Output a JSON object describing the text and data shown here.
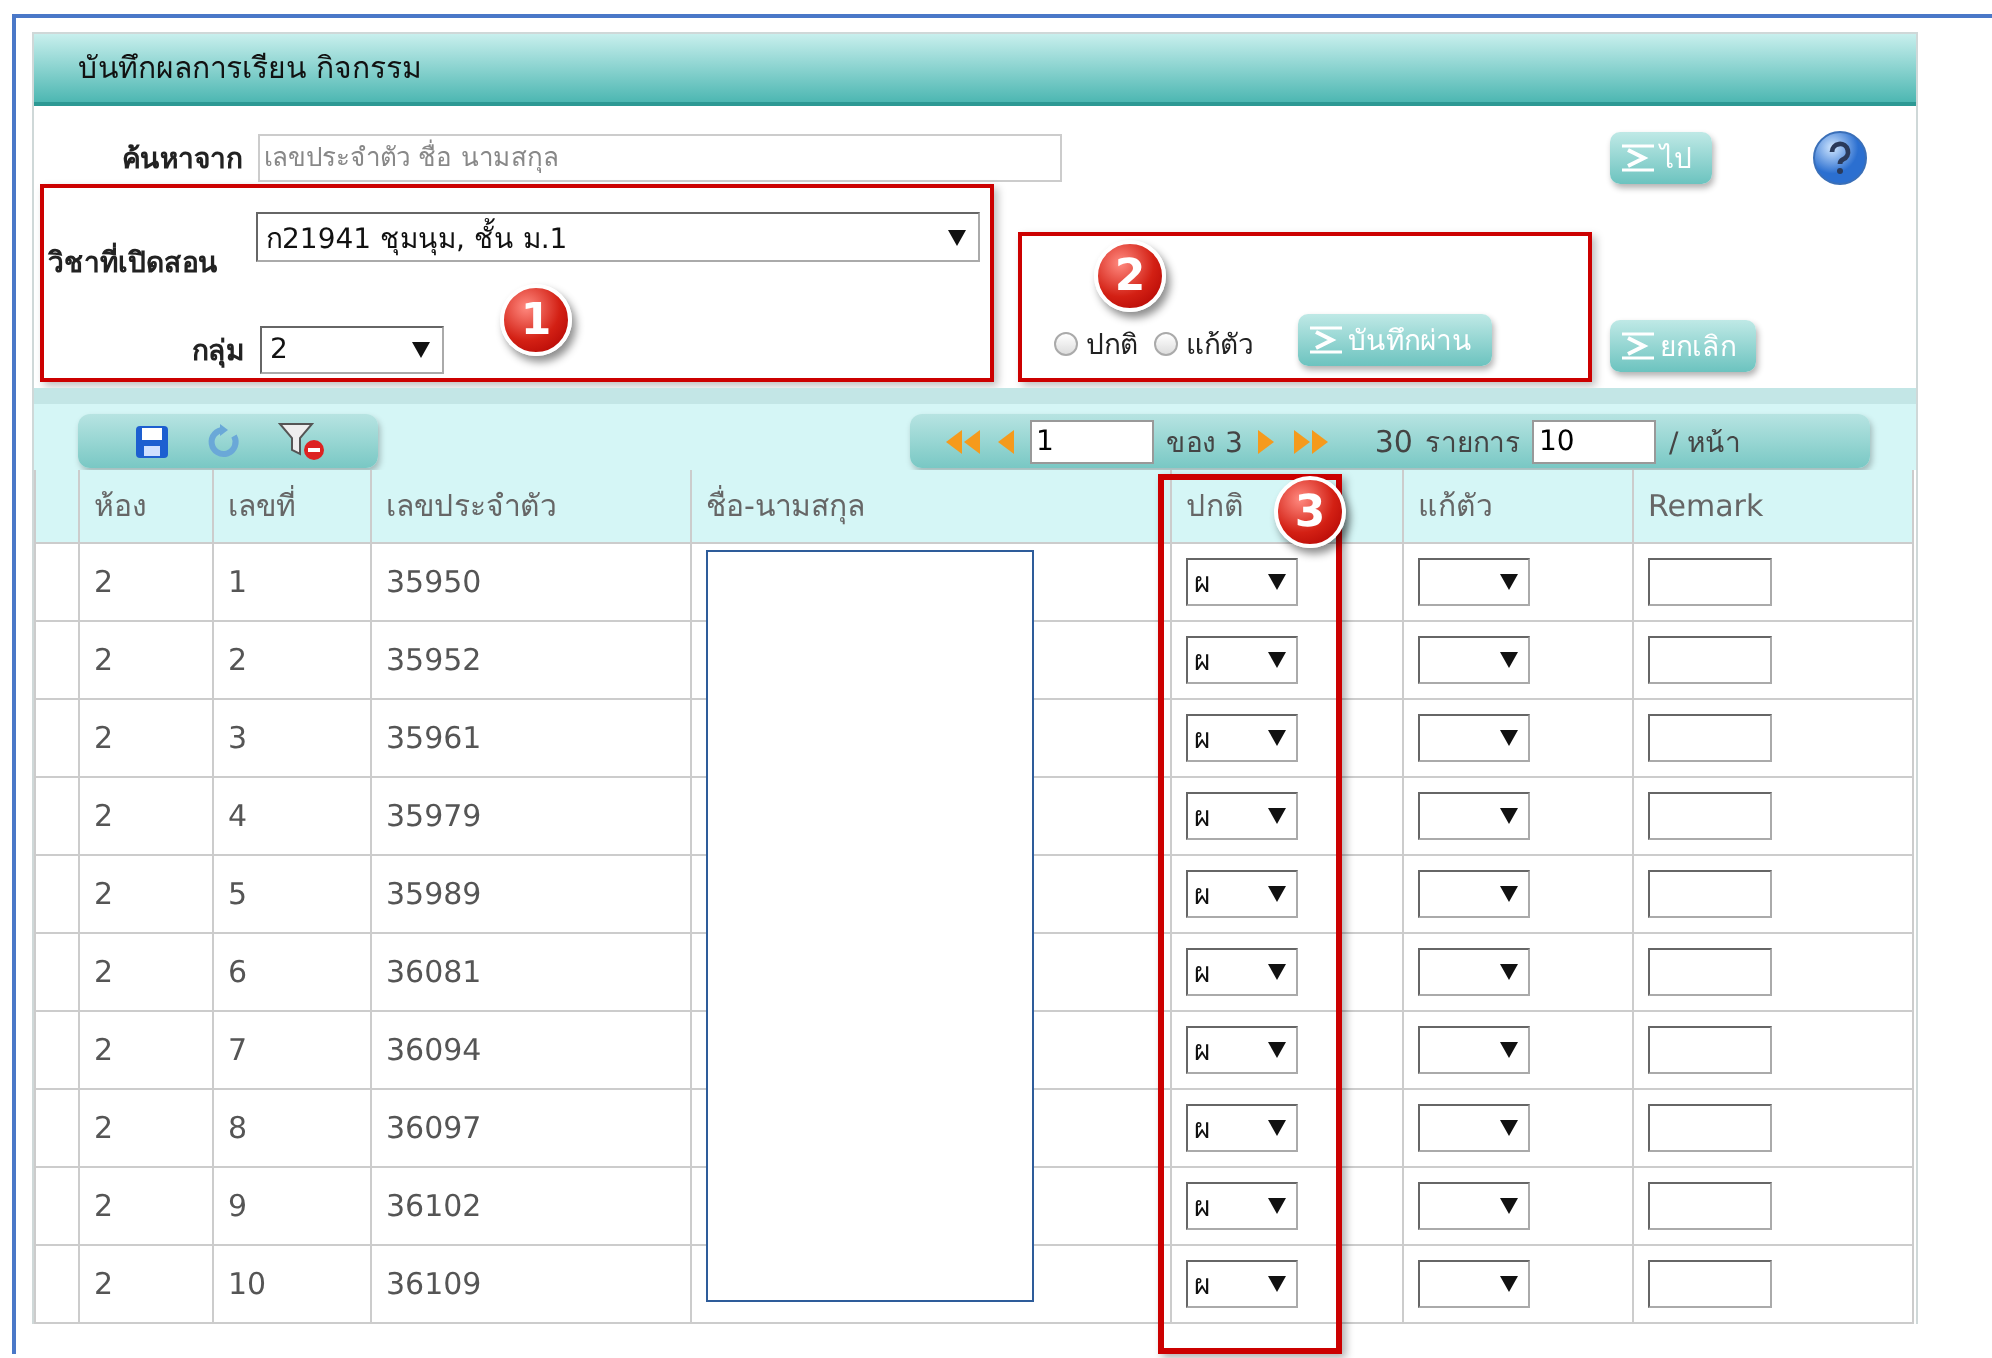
{
  "window": {
    "title": "บันทึกผลการเรียน กิจกรรม"
  },
  "search": {
    "label": "ค้นหาจาก",
    "placeholder": "เลขประจำตัว ชื่อ นามสกุล",
    "go_button": "ไป"
  },
  "subject": {
    "label": "วิชาที่เปิดสอน",
    "value": "ก21941 ชุมนุม, ชั้น ม.1"
  },
  "group": {
    "label": "กลุ่ม",
    "value": "2"
  },
  "annotations": [
    {
      "number": "1"
    },
    {
      "number": "2"
    },
    {
      "number": "3"
    }
  ],
  "mode_options": [
    {
      "label": "ปกติ",
      "selected": false
    },
    {
      "label": "แก้ตัว",
      "selected": false
    }
  ],
  "save_button": "บันทึกผ่าน",
  "cancel_button": "ยกเลิก",
  "pager": {
    "page": "1",
    "of": "ของ 3",
    "total": "30",
    "items_label": "รายการ",
    "per_page": "10",
    "per_page_label": "/ หน้า"
  },
  "table": {
    "columns": [
      "ห้อง",
      "เลขที่",
      "เลขประจำตัว",
      "ชื่อ-นามสกุล",
      "ปกติ",
      "แก้ตัว",
      "Remark"
    ],
    "rows": [
      {
        "room": "2",
        "no": "1",
        "student_id": "35950",
        "normal": "ผ"
      },
      {
        "room": "2",
        "no": "2",
        "student_id": "35952",
        "normal": "ผ"
      },
      {
        "room": "2",
        "no": "3",
        "student_id": "35961",
        "normal": "ผ"
      },
      {
        "room": "2",
        "no": "4",
        "student_id": "35979",
        "normal": "ผ"
      },
      {
        "room": "2",
        "no": "5",
        "student_id": "35989",
        "normal": "ผ"
      },
      {
        "room": "2",
        "no": "6",
        "student_id": "36081",
        "normal": "ผ"
      },
      {
        "room": "2",
        "no": "7",
        "student_id": "36094",
        "normal": "ผ"
      },
      {
        "room": "2",
        "no": "8",
        "student_id": "36097",
        "normal": "ผ"
      },
      {
        "room": "2",
        "no": "9",
        "student_id": "36102",
        "normal": "ผ"
      },
      {
        "room": "2",
        "no": "10",
        "student_id": "36109",
        "normal": "ผ"
      }
    ]
  }
}
